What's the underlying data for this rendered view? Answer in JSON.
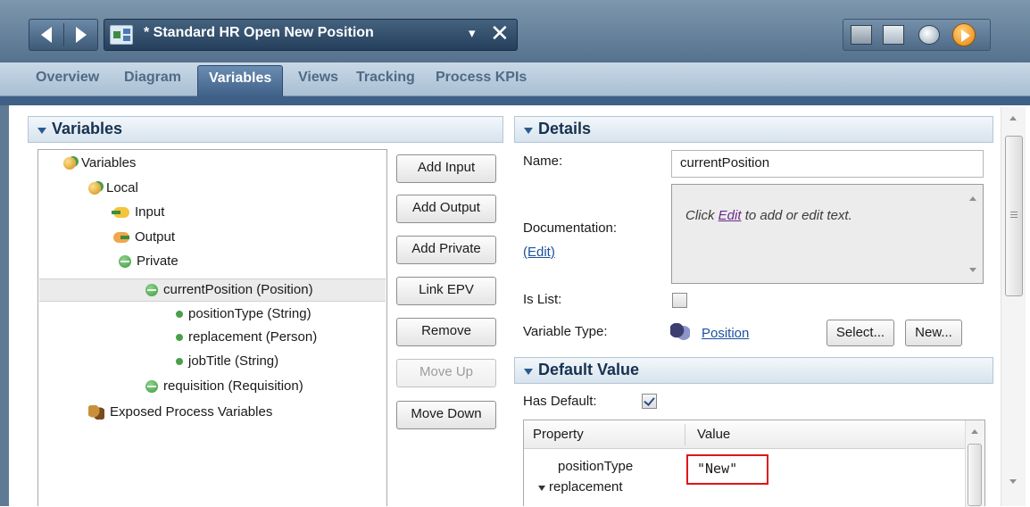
{
  "window": {
    "document_title": "* Standard HR Open New Position",
    "dropdown_glyph": "▾",
    "close_glyph": "✕"
  },
  "toolbar_icons": [
    "properties-icon",
    "chart-icon",
    "inspector-icon",
    "run-icon"
  ],
  "tabs": [
    {
      "label": "Overview",
      "active": false
    },
    {
      "label": "Diagram",
      "active": false
    },
    {
      "label": "Variables",
      "active": true
    },
    {
      "label": "Views",
      "active": false
    },
    {
      "label": "Tracking",
      "active": false
    },
    {
      "label": "Process KPIs",
      "active": false
    }
  ],
  "variables_section": {
    "title": "Variables",
    "tree": [
      {
        "label": "Variables",
        "icon": "variables-icon",
        "level": 0
      },
      {
        "label": "Local",
        "icon": "variables-icon",
        "level": 1
      },
      {
        "label": "Input",
        "icon": "input-icon",
        "level": 2
      },
      {
        "label": "Output",
        "icon": "output-icon",
        "level": 2
      },
      {
        "label": "Private",
        "icon": "private-icon",
        "level": 2
      },
      {
        "label": "currentPosition (Position)",
        "icon": "private-icon",
        "level": 3,
        "selected": true
      },
      {
        "label": "positionType (String)",
        "icon": "field-dot-icon",
        "level": 4
      },
      {
        "label": "replacement (Person)",
        "icon": "field-dot-icon",
        "level": 4
      },
      {
        "label": "jobTitle (String)",
        "icon": "field-dot-icon",
        "level": 4
      },
      {
        "label": "requisition (Requisition)",
        "icon": "private-icon",
        "level": 3
      },
      {
        "label": "Exposed Process Variables",
        "icon": "epv-icon",
        "level": 1
      }
    ],
    "buttons": [
      {
        "label": "Add Input",
        "enabled": true
      },
      {
        "label": "Add Output",
        "enabled": true
      },
      {
        "label": "Add Private",
        "enabled": true
      },
      {
        "label": "Link EPV",
        "enabled": true
      },
      {
        "label": "Remove",
        "enabled": true
      },
      {
        "label": "Move Up",
        "enabled": false
      },
      {
        "label": "Move Down",
        "enabled": true
      }
    ]
  },
  "details_section": {
    "title": "Details",
    "name_label": "Name:",
    "name_value": "currentPosition",
    "documentation_label": "Documentation:",
    "documentation_edit_link": "(Edit)",
    "documentation_placeholder_pre": "Click ",
    "documentation_placeholder_link": "Edit",
    "documentation_placeholder_post": " to add or edit text.",
    "is_list_label": "Is List:",
    "is_list_checked": false,
    "variable_type_label": "Variable Type:",
    "variable_type_value": "Position",
    "select_button": "Select...",
    "new_button": "New..."
  },
  "default_value_section": {
    "title": "Default Value",
    "has_default_label": "Has Default:",
    "has_default_checked": true,
    "table": {
      "columns": [
        "Property",
        "Value"
      ],
      "rows": [
        {
          "property": "positionType",
          "value": "\"New\"",
          "highlighted": true
        },
        {
          "property": "replacement",
          "value": "",
          "expandable": true
        }
      ]
    }
  },
  "colors": {
    "highlight_box": "#e0141b",
    "link": "#1c4f9e",
    "active_tab": "#3e5f86"
  }
}
